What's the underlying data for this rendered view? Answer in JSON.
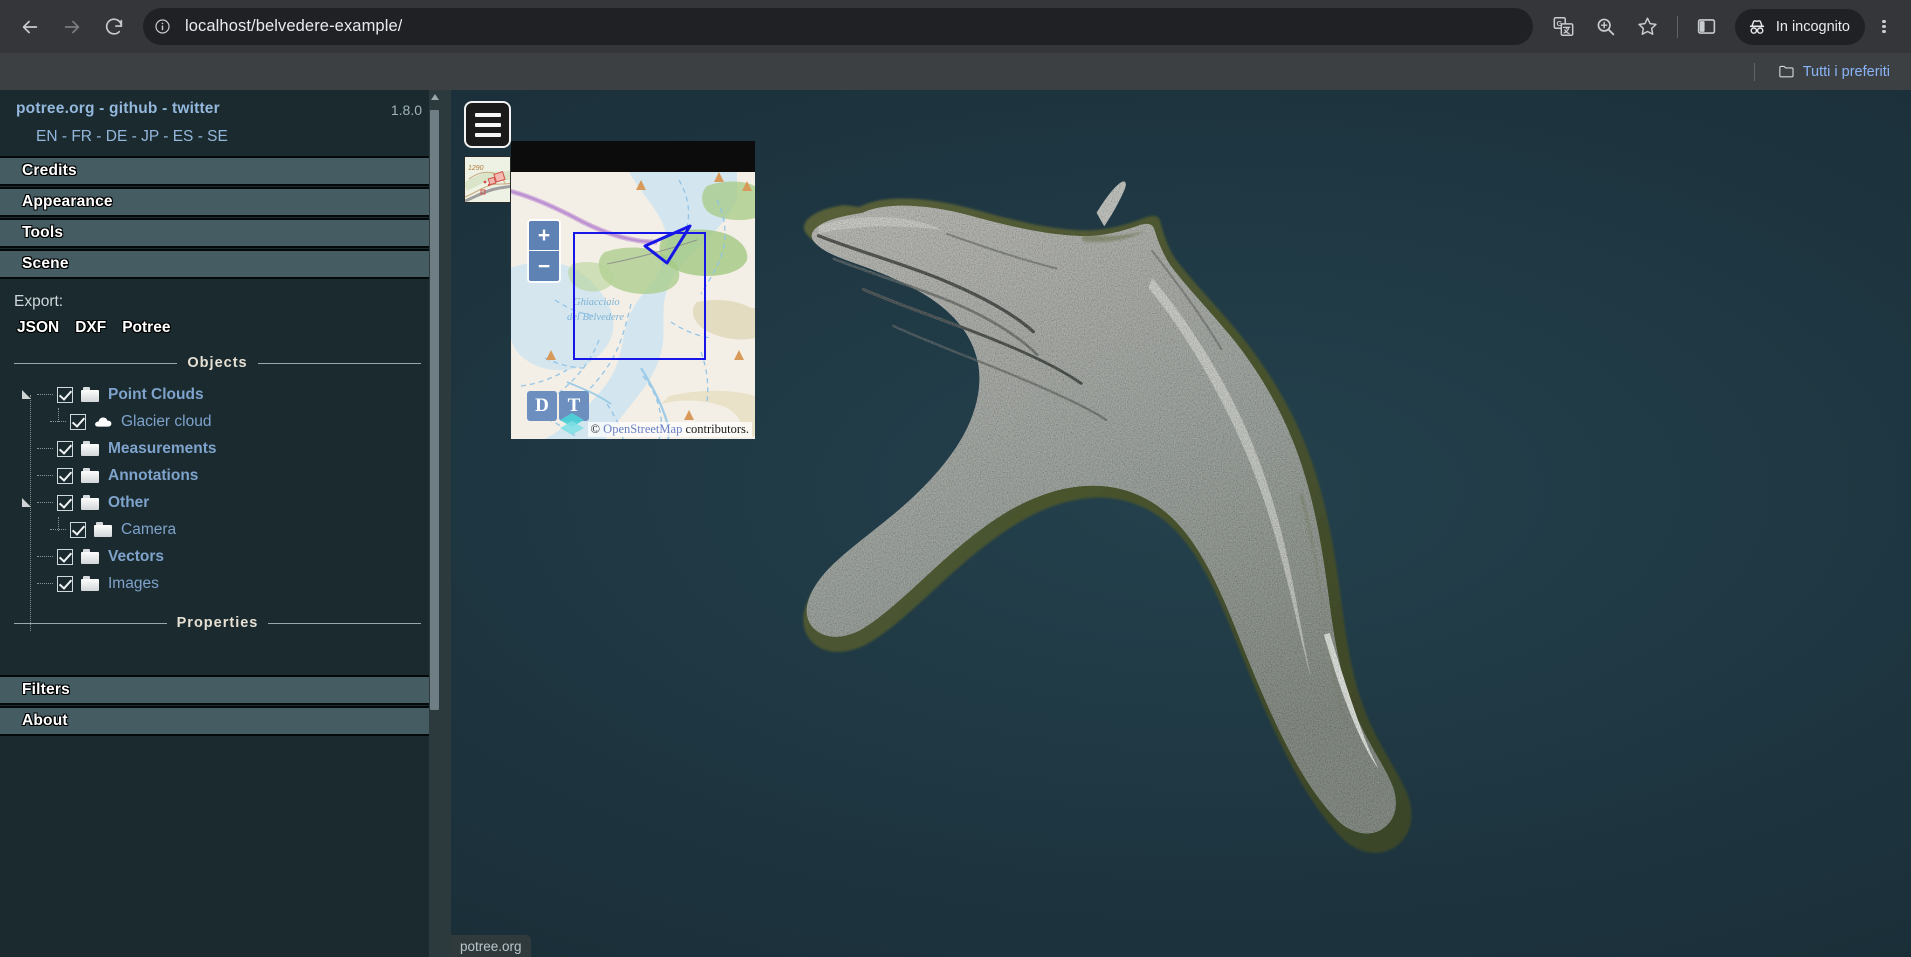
{
  "browser": {
    "back_label": "Back",
    "forward_label": "Forward",
    "reload_label": "Reload",
    "url": "localhost/belvedere-example/",
    "site_info_icon": "info-circle-icon",
    "translate_icon": "translate-icon",
    "zoom_icon": "zoom-search-icon",
    "bookmark_icon": "star-icon",
    "side_panel_icon": "side-panel-icon",
    "incognito_label": "In incognito",
    "incognito_icon": "incognito-hat-icon",
    "menu_icon": "kebab-menu-icon",
    "bookmarks": {
      "all_bookmarks_label": "Tutti i preferiti",
      "folder_icon": "folder-icon"
    }
  },
  "sidebar": {
    "version": "1.8.0",
    "links": [
      {
        "label": "potree.org",
        "name": "potree-org-link"
      },
      {
        "label": "github",
        "name": "github-link"
      },
      {
        "label": "twitter",
        "name": "twitter-link"
      }
    ],
    "separator": "-",
    "languages": [
      "EN",
      "FR",
      "DE",
      "JP",
      "ES",
      "SE"
    ],
    "accordions_top": [
      {
        "label": "Credits",
        "name": "accordion-credits"
      },
      {
        "label": "Appearance",
        "name": "accordion-appearance"
      },
      {
        "label": "Tools",
        "name": "accordion-tools"
      },
      {
        "label": "Scene",
        "name": "accordion-scene"
      }
    ],
    "export": {
      "label": "Export:",
      "formats": [
        "JSON",
        "DXF",
        "Potree"
      ]
    },
    "objects_title": "Objects",
    "properties_title": "Properties",
    "tree": [
      {
        "label": "Point Clouds",
        "icon": "folder-icon",
        "checked": true,
        "level": 0,
        "expandable": true,
        "bold": true
      },
      {
        "label": "Glacier cloud",
        "icon": "cloud-icon",
        "checked": true,
        "level": 1,
        "expandable": false,
        "bold": false
      },
      {
        "label": "Measurements",
        "icon": "folder-icon",
        "checked": true,
        "level": 0,
        "expandable": false,
        "bold": true
      },
      {
        "label": "Annotations",
        "icon": "folder-icon",
        "checked": true,
        "level": 0,
        "expandable": false,
        "bold": true
      },
      {
        "label": "Other",
        "icon": "folder-icon",
        "checked": true,
        "level": 0,
        "expandable": true,
        "bold": true
      },
      {
        "label": "Camera",
        "icon": "folder-icon",
        "checked": true,
        "level": 1,
        "expandable": false,
        "bold": false
      },
      {
        "label": "Vectors",
        "icon": "folder-icon",
        "checked": true,
        "level": 0,
        "expandable": false,
        "bold": true
      },
      {
        "label": "Images",
        "icon": "folder-icon",
        "checked": true,
        "level": 0,
        "expandable": false,
        "bold": false
      }
    ],
    "accordions_bottom": [
      {
        "label": "Filters",
        "name": "accordion-filters"
      },
      {
        "label": "About",
        "name": "accordion-about"
      }
    ]
  },
  "viewer": {
    "menu_toggle_icon": "hamburger-menu-icon",
    "status_text": "potree.org",
    "map": {
      "zoom_in_label": "+",
      "zoom_out_label": "−",
      "layer_buttons": [
        "D",
        "T"
      ],
      "layers_icon": "layers-icon",
      "place_label_line1": "Ghiacciaio",
      "place_label_line2": "del Belvedere",
      "contour_label": "1290",
      "attribution_copyright": "©",
      "attribution_link": "OpenStreetMap",
      "attribution_suffix": "contributors."
    }
  },
  "colors": {
    "chrome_toolbar": "#35363a",
    "bookmarks_bar": "#3c4043",
    "omnibox": "#202124",
    "link_blue": "#8ab4f8",
    "sidebar_bg": "#1b2a2e",
    "accordion_bg": "#455c63",
    "tree_label": "#7ea3cc",
    "viewer_bg": "#1e3641",
    "map_rect_blue": "#1616e8",
    "map_button_blue": "#6d8fbf"
  }
}
